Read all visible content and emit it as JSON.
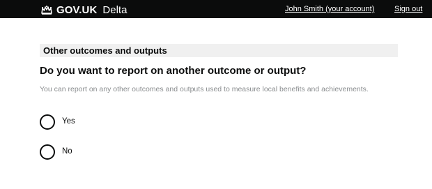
{
  "header": {
    "brand": "GOV.UK",
    "product": "Delta",
    "account_link": "John Smith (your account)",
    "signout_link": "Sign out",
    "logo_icon": "crown-icon"
  },
  "section": {
    "title": "Other outcomes and outputs"
  },
  "question": {
    "text": "Do you want to report on another outcome or output?",
    "hint": "You can report on any other outcomes and outputs used to measure local benefits and achievements.",
    "options": [
      {
        "label": "Yes",
        "selected": false
      },
      {
        "label": "No",
        "selected": false
      }
    ]
  },
  "colors": {
    "header_bg": "#0b0c0c",
    "section_bg": "#f0f0f0",
    "hint_text": "#8a8d8f"
  }
}
